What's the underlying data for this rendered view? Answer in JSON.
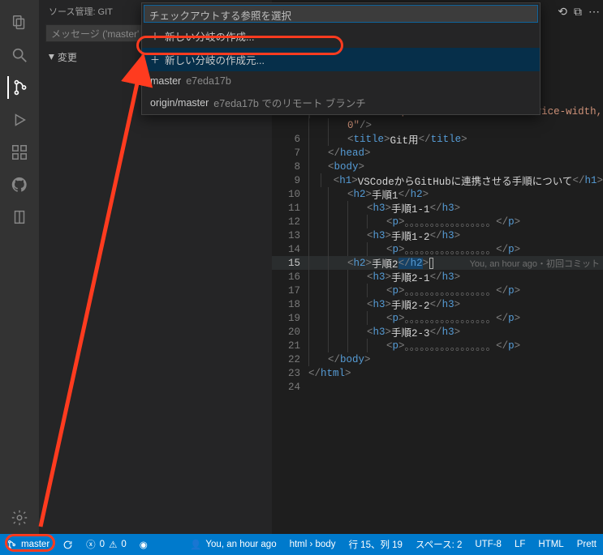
{
  "sidebar": {
    "title": "ソース管理: GIT",
    "message_placeholder": "メッセージ ('master'",
    "section_changes": "変更"
  },
  "quickpick": {
    "input_placeholder": "チェックアウトする参照を選択",
    "items": [
      {
        "icon": "plus",
        "label": "新しい分岐の作成...",
        "desc": ""
      },
      {
        "icon": "plus",
        "label": "新しい分岐の作成元...",
        "desc": ""
      },
      {
        "icon": "",
        "label": "master",
        "desc": "e7eda17b"
      },
      {
        "icon": "",
        "label": "origin/master",
        "desc": "e7eda17b でのリモート ブランチ"
      }
    ]
  },
  "statusbar": {
    "branch": "master",
    "sync": "",
    "err": "0",
    "warn": "0",
    "live": "",
    "blame": "You, an hour ago",
    "breadcrumb": "html › body",
    "cursor": "行 15、列 19",
    "spaces": "スペース: 2",
    "encoding": "UTF-8",
    "eol": "LF",
    "lang": "HTML",
    "pretty": "Prett"
  },
  "codelens": "You, an hour ago・初回コミット",
  "code": []
}
